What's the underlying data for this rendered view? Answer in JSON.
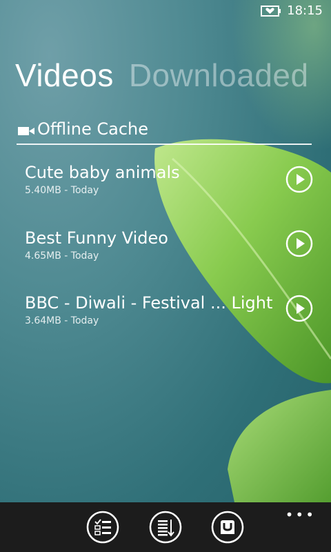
{
  "status_bar": {
    "time": "18:15",
    "battery_icon": "battery-heart-icon"
  },
  "pivot": {
    "tabs": [
      {
        "label": "Videos",
        "active": true
      },
      {
        "label": "Downloaded",
        "active": false
      }
    ]
  },
  "section": {
    "icon": "video-camera-icon",
    "title": "Offline Cache"
  },
  "videos": [
    {
      "title": "Cute baby animals",
      "meta": "5.40MB - Today",
      "icon": "play-icon"
    },
    {
      "title": "Best Funny Video",
      "meta": "4.65MB - Today",
      "icon": "play-icon"
    },
    {
      "title": "BBC - Diwali - Festival ... Light",
      "meta": "3.64MB - Today",
      "icon": "play-icon"
    }
  ],
  "app_bar": {
    "buttons": [
      {
        "icon": "select-list-icon"
      },
      {
        "icon": "sort-icon"
      },
      {
        "icon": "app-store-icon"
      }
    ],
    "more": "•••"
  },
  "colors": {
    "background": "#4f8a92",
    "leaf": "#8fd24a",
    "app_bar": "#1c1c1c"
  }
}
